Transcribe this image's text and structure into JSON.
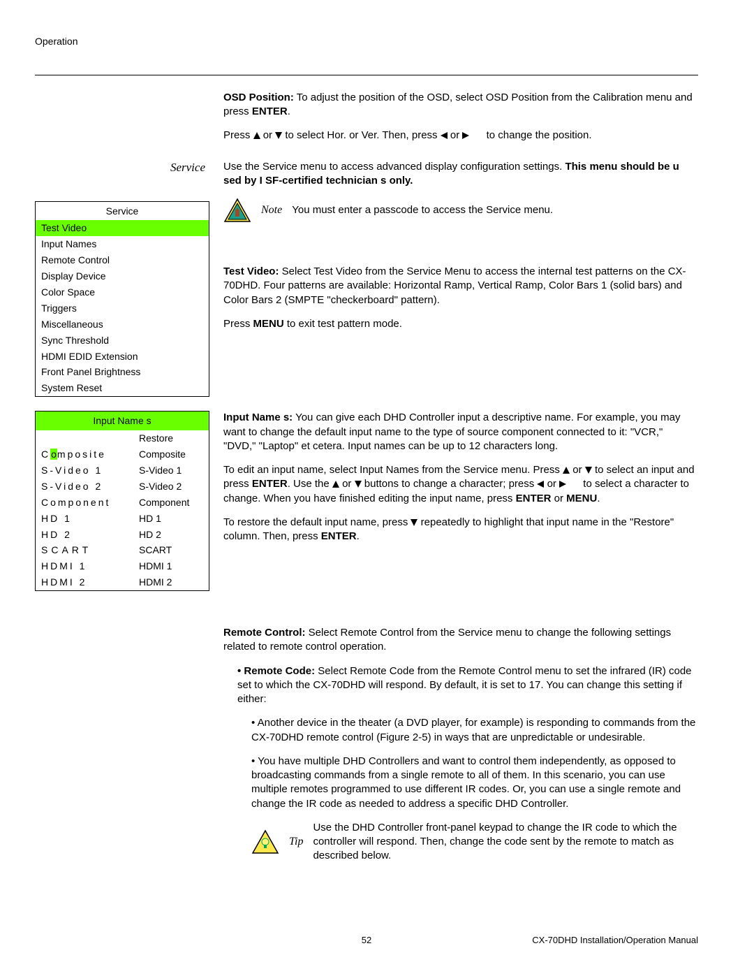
{
  "header": "Operation",
  "osd": {
    "p1a": "OSD Position:",
    "p1b": " To adjust the position of the OSD, select OSD Position from the Calibration menu and press ",
    "p1c": "ENTER",
    "p1d": ".",
    "p2a": "Press ",
    "p2b": " or ",
    "p2c": " to select Hor. or Ver. Then, press ",
    "p2d": " or ",
    "p2e": " to change the position."
  },
  "service": {
    "heading": "Service",
    "intro_a": "Use the Service menu to access advanced display configuration settings. ",
    "intro_b": "This menu should be u sed by I SF-certified technician s only.",
    "note_label": "Note",
    "note_text": "You must enter a passcode to access the Service menu.",
    "menu_title": "Service",
    "menu_items": [
      "Test Video",
      "Input Names",
      "Remote Control",
      "Display Device",
      "Color Space",
      "Triggers",
      "Miscellaneous",
      "Sync Threshold",
      "HDMI EDID Extension",
      "Front Panel Brightness",
      "System Reset"
    ]
  },
  "test_video": {
    "p1": "Test Video: Select Test Video from the Service Menu to access the internal test patterns on the CX-70DHD. Four patterns are available: Horizontal Ramp, Vertical Ramp, Color Bars 1 (solid bars) and Color Bars 2 (SMPTE \"checkerboard\" pattern).",
    "p2a": "Press ",
    "p2b": "MENU",
    "p2c": " to exit test pattern mode."
  },
  "input_names": {
    "p1": "Input Name s: You can give each DHD Controller input a descriptive name. For example, you may want to change the default input name to the type of source component connected to it: \"VCR,\" \"DVD,\" \"Laptop\" et cetera. Input names can be up to 12 characters long.",
    "p2a": "To edit an input name, select Input Names from the Service menu. Press ",
    "p2b": " or ",
    "p2c": " to select an input and press ",
    "p2d": "ENTER",
    "p2e": ". Use the ",
    "p2f": " or ",
    "p2g": " buttons to change a character; press ",
    "p2h": " or ",
    "p2i": " to select a character to change. When you have finished editing the input name, press ",
    "p2j": "ENTER",
    "p2k": " or ",
    "p2l": "MENU",
    "p2m": ".",
    "p3a": "To restore the default input name, press ",
    "p3b": " repeatedly to highlight that input name in the \"Restore\" column. Then, press ",
    "p3c": "ENTER",
    "p3d": ".",
    "table_title": "Input Name s",
    "restore_header": "Restore",
    "rows": [
      {
        "left_pre": "C",
        "left_cur": "o",
        "left_post": "mposite",
        "right": "Composite"
      },
      {
        "left": "S-Video 1",
        "right": "S-Video 1"
      },
      {
        "left": "S-Video 2",
        "right": "S-Video 2"
      },
      {
        "left": "Component",
        "right": "Component"
      },
      {
        "left": "HD 1",
        "right": "HD 1"
      },
      {
        "left": "HD 2",
        "right": "HD 2"
      },
      {
        "left": "SCART",
        "right": "SCART"
      },
      {
        "left": "HDMI 1",
        "right": "HDMI 1"
      },
      {
        "left": "HDMI 2",
        "right": "HDMI 2"
      }
    ]
  },
  "remote": {
    "p1": "Remote Control:  Select Remote Control from the Service menu to change the following settings related to remote control operation.",
    "p2": "Remote Code:  Select Remote Code from the Remote Control menu to set the infrared (IR) code set to which the CX-70DHD will respond. By default, it is set to 17. You can change this setting if either:",
    "b1": "Another device in the theater (a DVD player, for example) is responding to commands from the CX-70DHD remote control (Figure 2-5) in ways that are unpredictable or undesirable.",
    "b2": "You have multiple DHD Controllers and want to control them independently, as opposed to broadcasting commands from a single remote to all of them. In this scenario, you can use multiple remotes programmed to use different IR codes. Or, you can use a single remote and change the IR code as needed to address a specific DHD Controller.",
    "tip_label": "Tip",
    "tip_text": "Use the DHD Controller front-panel keypad to change the IR code to which the controller will respond. Then, change the code sent by the remote to match as described below."
  },
  "footer": {
    "page": "52",
    "manual": "CX-70DHD Installation/Operation Manual"
  }
}
